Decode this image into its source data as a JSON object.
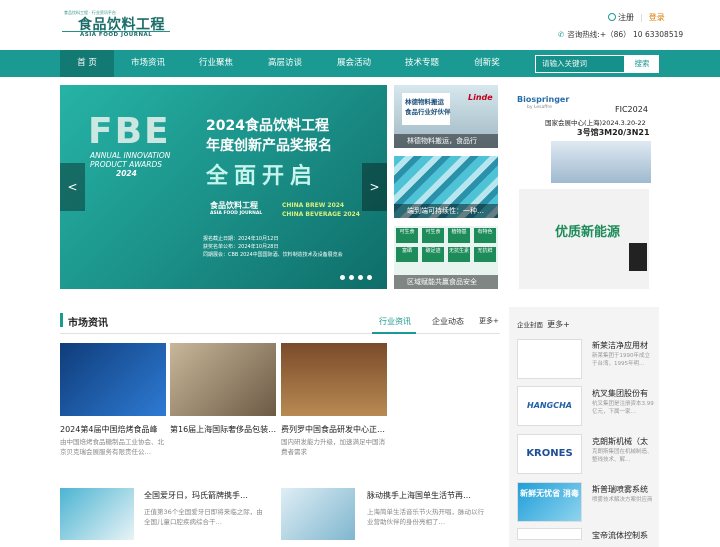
{
  "header": {
    "logo_tagline": "食品饮料工程 · 行业资讯平台",
    "logo_cn": "食品饮料工程",
    "logo_en": "ASIA FOOD JOURNAL",
    "register": "注册",
    "login": "登录",
    "hotline": "咨询热线:+（86） 10 63308519"
  },
  "nav": {
    "items": [
      "首 页",
      "市场资讯",
      "行业聚焦",
      "高层访谈",
      "展会活动",
      "技术专题",
      "创新奖"
    ],
    "search_placeholder": "请输入关键词",
    "search_button": "搜索"
  },
  "banner": {
    "logo_text": "FBE",
    "awards_line1": "ANNUAL INNOVATION",
    "awards_line2": "PRODUCT AWARDS",
    "awards_year": "2024",
    "title1": "2024食品饮料工程",
    "title2": "年度创新产品奖报名",
    "title3": "全面开启",
    "brand": "食品饮料工程",
    "brand_en": "ASIA FOOD JOURNAL",
    "expo1": "CHINA BREW 2024",
    "expo2": "CHINA BEVERAGE 2024",
    "deadline": "报名截止日期：2024年10月12日",
    "announce": "获奖名单公布：2024年10月28日",
    "ceremony": "同期展会：CBB 2024中国国际酒、饮料制造技术及设备展览会",
    "prev": "<",
    "next": ">"
  },
  "tiles": [
    {
      "caption": "林德物料搬运，食品行",
      "image_text": "林德物料搬运",
      "image_sub": "食品行业好伙伴",
      "brand": "Linde"
    },
    {
      "caption": "端到端可持续性：一种…"
    },
    {
      "caption": "区域赋能共赢食品安全",
      "labels": [
        "可生食",
        "可生食",
        "植物基",
        "有特色",
        "富硒",
        "碳足迹",
        "无抗生素",
        "无抗鲜"
      ]
    }
  ],
  "ad": {
    "brand": "Biospringer",
    "brand_sub": "by Lesaffre",
    "event": "FIC2024",
    "venue": "国家会展中心(上海)2024.3.20-22",
    "booth": "3号馆3M20/3N21",
    "partial_text": "优质新能源"
  },
  "market": {
    "title": "市场资讯",
    "tabs": [
      "行业资讯",
      "企业动态",
      "更多+"
    ],
    "cards": [
      {
        "title": "2024第4届中国焙烤食品峰",
        "desc": "由中国焙烤食品糖制品工业协会、北京贝克瑞会展服务有限责任公…"
      },
      {
        "title": "第16届上海国际奢侈品包装…",
        "desc": ""
      },
      {
        "title": "费列罗中国食品研发中心正…",
        "desc": "国内研发能力升级，加速满足中国消费者需求"
      }
    ],
    "list": [
      {
        "title": "全国爱牙日，玛氏箭牌携手…",
        "desc": "正值第36个全国爱牙日即将来临之际，由全国儿童口腔疾病综合干…"
      },
      {
        "title": "脉动携手上海国单生活节再…",
        "desc": "上海简单生活音乐节火热开唱，脉动以行业营助伙伴的身份亮相了…"
      }
    ]
  },
  "sidebar": {
    "tab": "企业封面",
    "more": "更多+",
    "companies": [
      {
        "name": "新莱洁净应用材",
        "desc": "新莱集团于1990年成立于台湾，1995年明…",
        "logo": ""
      },
      {
        "name": "杭叉集团股份有",
        "desc": "杭叉集团是注册资本3.99亿元，下属一家…",
        "logo": "HANGCHA"
      },
      {
        "name": "克朗斯机械（太",
        "desc": "克朗斯集团在机械制造、整线技术、解…",
        "logo": "KRONES"
      },
      {
        "name": "斯普瑞喷雾系统",
        "desc": "喷雾技术解决方案供应商",
        "logo": "新鲜无忧省 消毒"
      },
      {
        "name": "宝帝流体控制系",
        "desc": "",
        "logo": ""
      }
    ]
  },
  "colors": {
    "primary": "#1a9a92",
    "dark": "#137a73",
    "accent": "#e07b00"
  }
}
